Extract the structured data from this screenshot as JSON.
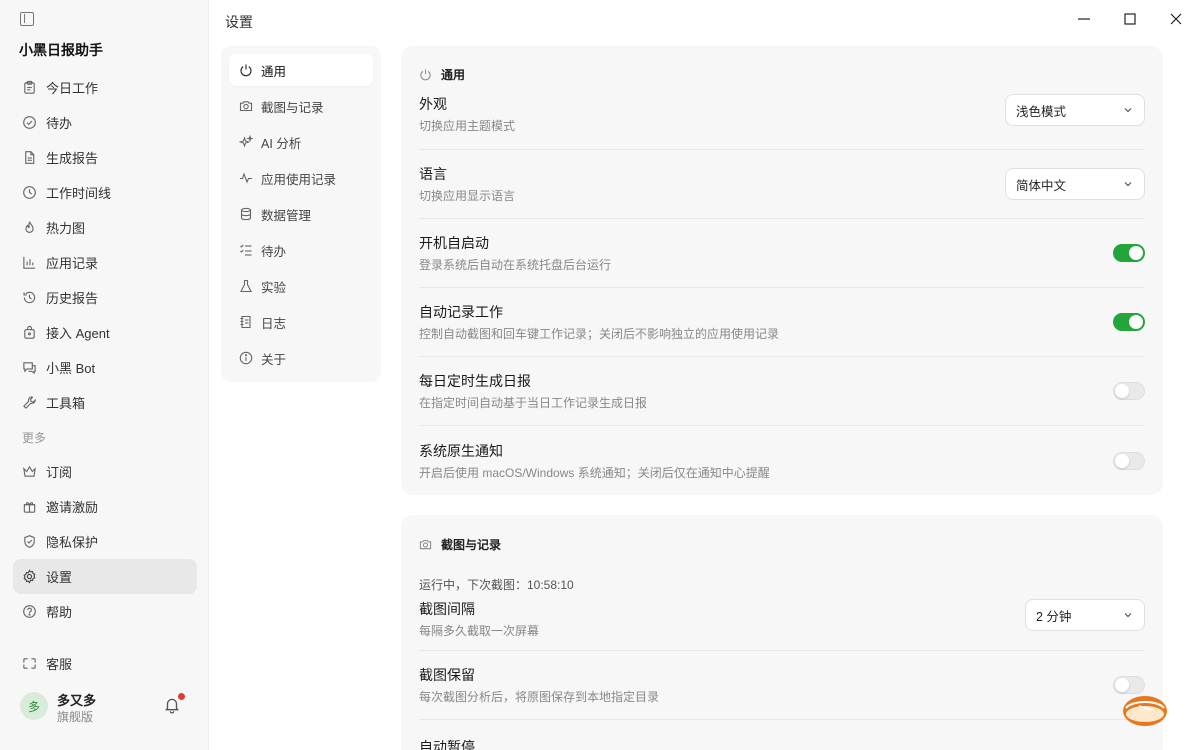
{
  "app": {
    "title": "小黑日报助手",
    "page_title": "设置"
  },
  "sidebar": {
    "items": [
      {
        "label": "今日工作",
        "icon": "clipboard-icon"
      },
      {
        "label": "待办",
        "icon": "check-circle-icon"
      },
      {
        "label": "生成报告",
        "icon": "document-icon"
      },
      {
        "label": "工作时间线",
        "icon": "clock-icon"
      },
      {
        "label": "热力图",
        "icon": "flame-icon"
      },
      {
        "label": "应用记录",
        "icon": "bar-chart-icon"
      },
      {
        "label": "历史报告",
        "icon": "history-icon"
      },
      {
        "label": "接入 Agent",
        "icon": "plug-icon"
      },
      {
        "label": "小黑 Bot",
        "icon": "chat-icon"
      },
      {
        "label": "工具箱",
        "icon": "wrench-icon"
      }
    ],
    "section_more": "更多",
    "more_items": [
      {
        "label": "订阅",
        "icon": "crown-icon"
      },
      {
        "label": "邀请激励",
        "icon": "gift-icon"
      },
      {
        "label": "隐私保护",
        "icon": "shield-icon"
      },
      {
        "label": "设置",
        "icon": "gear-icon",
        "active": true
      },
      {
        "label": "帮助",
        "icon": "help-icon"
      }
    ],
    "support": {
      "label": "客服",
      "icon": "support-icon"
    },
    "user": {
      "avatar": "多",
      "name": "多又多",
      "plan": "旗舰版"
    }
  },
  "settings_nav": {
    "items": [
      {
        "label": "通用",
        "icon": "power-icon",
        "active": true
      },
      {
        "label": "截图与记录",
        "icon": "camera-icon"
      },
      {
        "label": "AI 分析",
        "icon": "sparkle-icon"
      },
      {
        "label": "应用使用记录",
        "icon": "activity-icon"
      },
      {
        "label": "数据管理",
        "icon": "database-icon"
      },
      {
        "label": "待办",
        "icon": "checklist-icon"
      },
      {
        "label": "实验",
        "icon": "flask-icon"
      },
      {
        "label": "日志",
        "icon": "log-icon"
      },
      {
        "label": "关于",
        "icon": "info-icon"
      }
    ]
  },
  "general": {
    "title": "通用",
    "appearance": {
      "label": "外观",
      "desc": "切换应用主题模式",
      "value": "浅色模式"
    },
    "language": {
      "label": "语言",
      "desc": "切换应用显示语言",
      "value": "简体中文"
    },
    "autostart": {
      "label": "开机自启动",
      "desc": "登录系统后自动在系统托盘后台运行",
      "enabled": true
    },
    "auto_record": {
      "label": "自动记录工作",
      "desc": "控制自动截图和回车键工作记录；关闭后不影响独立的应用使用记录",
      "enabled": true
    },
    "daily_report": {
      "label": "每日定时生成日报",
      "desc": "在指定时间自动基于当日工作记录生成日报",
      "enabled": false
    },
    "native_notify": {
      "label": "系统原生通知",
      "desc": "开启后使用 macOS/Windows 系统通知；关闭后仅在通知中心提醒",
      "enabled": false
    }
  },
  "capture": {
    "title": "截图与记录",
    "status": "运行中，下次截图：10:58:10",
    "interval": {
      "label": "截图间隔",
      "desc": "每隔多久截取一次屏幕",
      "value": "2 分钟"
    },
    "retain": {
      "label": "截图保留",
      "desc": "每次截图分析后，将原图保存到本地指定目录",
      "enabled": false
    },
    "next_label": "自动暂停"
  },
  "colors": {
    "accent": "#22a53a",
    "notify_dot": "#e53935"
  }
}
